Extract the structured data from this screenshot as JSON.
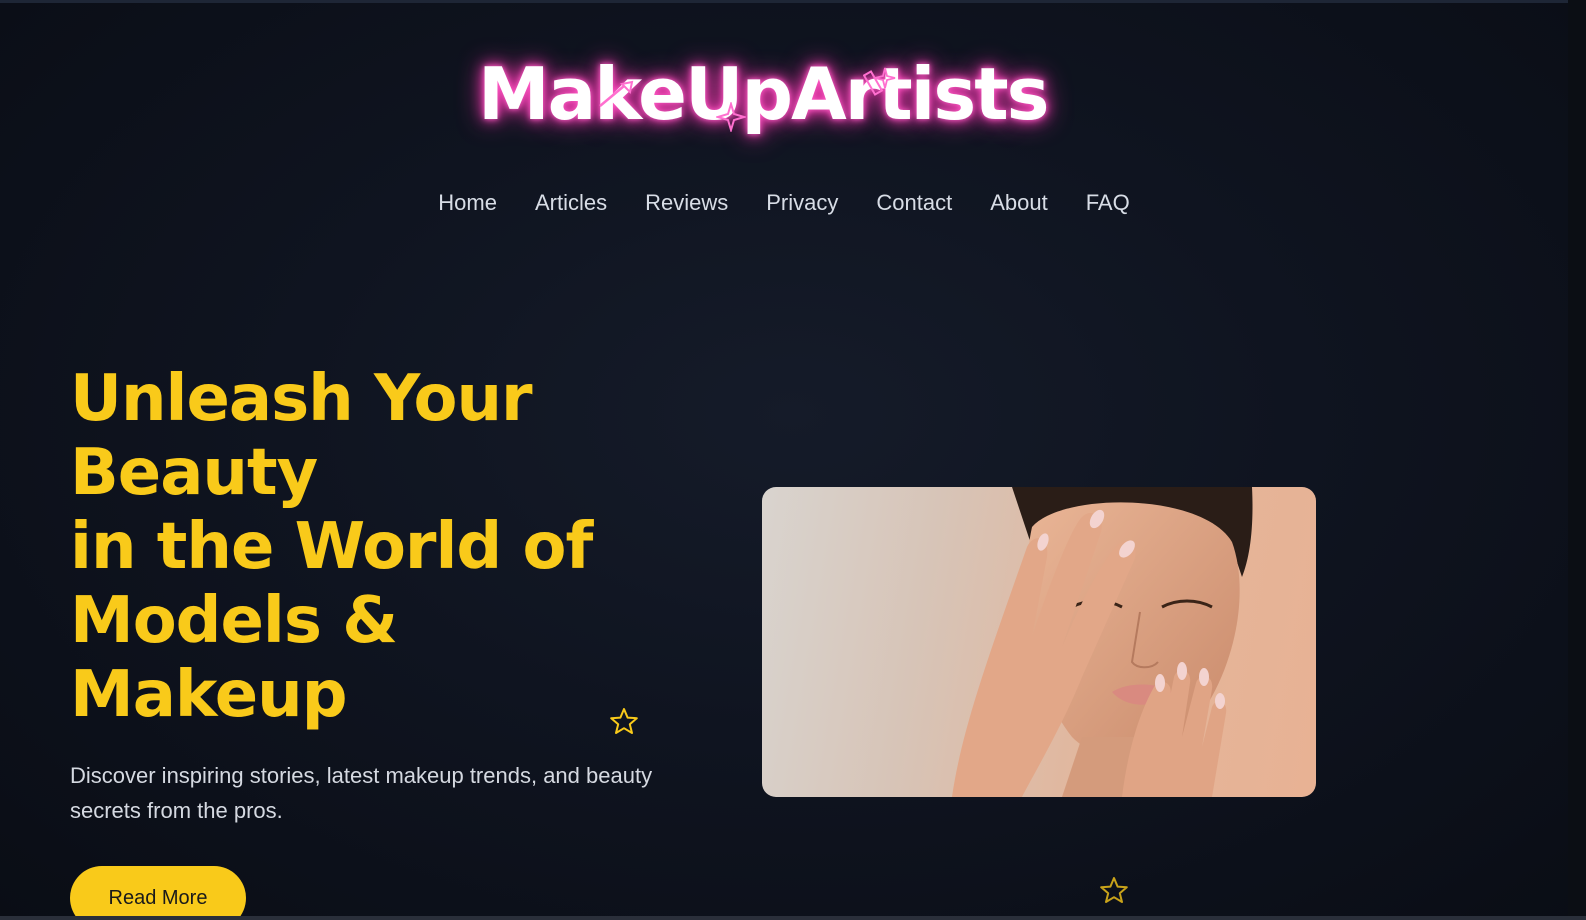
{
  "brand": {
    "logo_text": "MakeUpArtists",
    "glow_color": "#ff3fb8"
  },
  "nav": {
    "items": [
      {
        "label": "Home"
      },
      {
        "label": "Articles"
      },
      {
        "label": "Reviews"
      },
      {
        "label": "Privacy"
      },
      {
        "label": "Contact"
      },
      {
        "label": "About"
      },
      {
        "label": "FAQ"
      }
    ]
  },
  "hero": {
    "title_lines": [
      "Unleash Your",
      "Beauty",
      "in the World of",
      "Models &",
      "Makeup"
    ],
    "description": "Discover inspiring stories, latest makeup trends, and beauty secrets from the pros.",
    "cta_label": "Read More",
    "accent_color": "#f9ca1a",
    "image_icon": "woman-face-portrait"
  },
  "decorations": {
    "star_icon": "star-outline-icon"
  }
}
